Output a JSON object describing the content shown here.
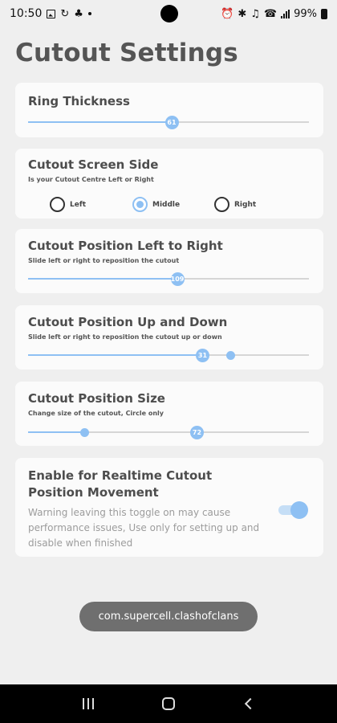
{
  "status_bar": {
    "time": "10:50",
    "battery_text": "99%",
    "left_icons": [
      "image-icon",
      "data-saver-icon",
      "cat-icon",
      "dot-icon"
    ],
    "right_icons": [
      "alarm-icon",
      "bluetooth-icon",
      "mute-icon",
      "wifi-call-icon",
      "signal-icon",
      "battery-icon"
    ]
  },
  "page": {
    "title": "Cutout Settings"
  },
  "ring_thickness": {
    "title": "Ring Thickness",
    "value": "61",
    "fraction": 0.51
  },
  "screen_side": {
    "title": "Cutout Screen Side",
    "subtitle": "Is your Cutout Centre Left or Right",
    "options": [
      "Left",
      "Middle",
      "Right"
    ],
    "selected": "Middle"
  },
  "position_lr": {
    "title": "Cutout Position Left to Right",
    "subtitle": "Slide left or right to reposition the cutout",
    "value": "109",
    "fraction": 0.53
  },
  "position_ud": {
    "title": "Cutout Position Up and Down",
    "subtitle": "Slide left or right to reposition the cutout up or down",
    "value": "31",
    "fraction": 0.62,
    "secondary_fraction": 0.72
  },
  "position_size": {
    "title": "Cutout Position Size",
    "subtitle": "Change size of the cutout, Circle only",
    "value": "72",
    "fraction": 0.6,
    "secondary_fraction": 0.2
  },
  "realtime": {
    "title": "Enable for Realtime Cutout Position Movement",
    "warning": "Warning leaving this toggle on may cause performance issues, Use only for setting up and disable when finished",
    "enabled": true
  },
  "toast": {
    "text": "com.supercell.clashofclans"
  },
  "colors": {
    "accent": "#8ec0f3",
    "background": "#efefef",
    "card": "#fbfbfb"
  }
}
